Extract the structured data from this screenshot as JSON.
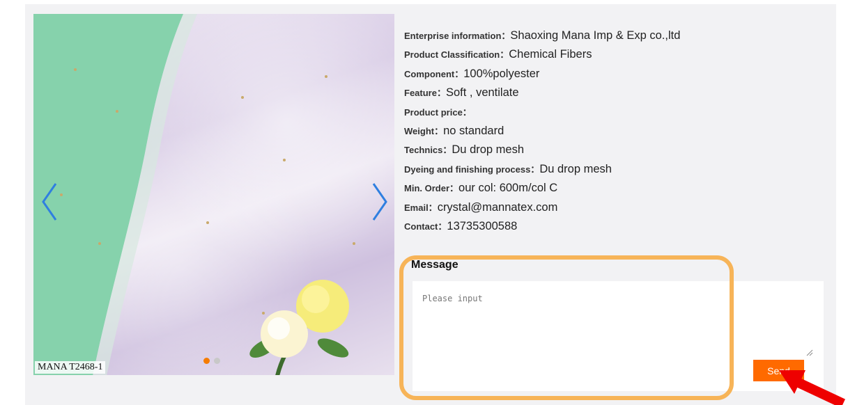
{
  "gallery": {
    "caption": "MANA T2468-1",
    "slide_count": 2,
    "active_slide": 1,
    "prev_icon": "chevron-left-icon",
    "next_icon": "chevron-right-icon"
  },
  "product": {
    "rows": [
      {
        "label": "Enterprise information：",
        "value": "Shaoxing Mana Imp & Exp co.,ltd"
      },
      {
        "label": "Product Classification：",
        "value": "Chemical Fibers"
      },
      {
        "label": "Component：",
        "value": "100%polyester"
      },
      {
        "label": "Feature：",
        "value": "Soft , ventilate"
      },
      {
        "label": "Product price：",
        "value": ""
      },
      {
        "label": "Weight：",
        "value": "no standard"
      },
      {
        "label": "Technics：",
        "value": "Du drop mesh"
      },
      {
        "label": "Dyeing and finishing process：",
        "value": "Du drop mesh"
      },
      {
        "label": "Min. Order：",
        "value": "our col: 600m/col C"
      },
      {
        "label": "Email：",
        "value": "crystal@mannatex.com"
      },
      {
        "label": "Contact：",
        "value": "13735300588"
      }
    ]
  },
  "message": {
    "title": "Message",
    "placeholder": "Please input",
    "send_label": "Send"
  },
  "colors": {
    "accent": "#ff6a00",
    "highlight": "#f7b458",
    "pointer": "#ee0000",
    "arrow": "#2f7fe0"
  }
}
